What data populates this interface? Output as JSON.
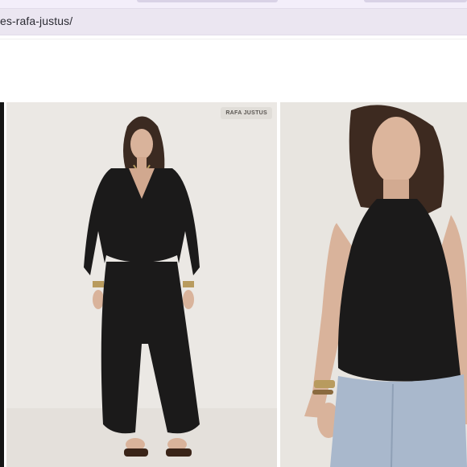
{
  "browser": {
    "url_fragment": "es-rafa-justus/"
  },
  "gallery": {
    "brand_badge": "RAFA JUSTUS",
    "images": [
      {
        "alt": "product-photo-edge"
      },
      {
        "alt": "model-black-jacquard-wrap-top-and-balloon-pants"
      },
      {
        "alt": "model-black-jacquard-halter-top-with-jeans"
      }
    ]
  },
  "colors": {
    "garment": "#1b1a1a",
    "backdrop": "#e9e6e2",
    "address_bar": "#ebe6f1"
  }
}
